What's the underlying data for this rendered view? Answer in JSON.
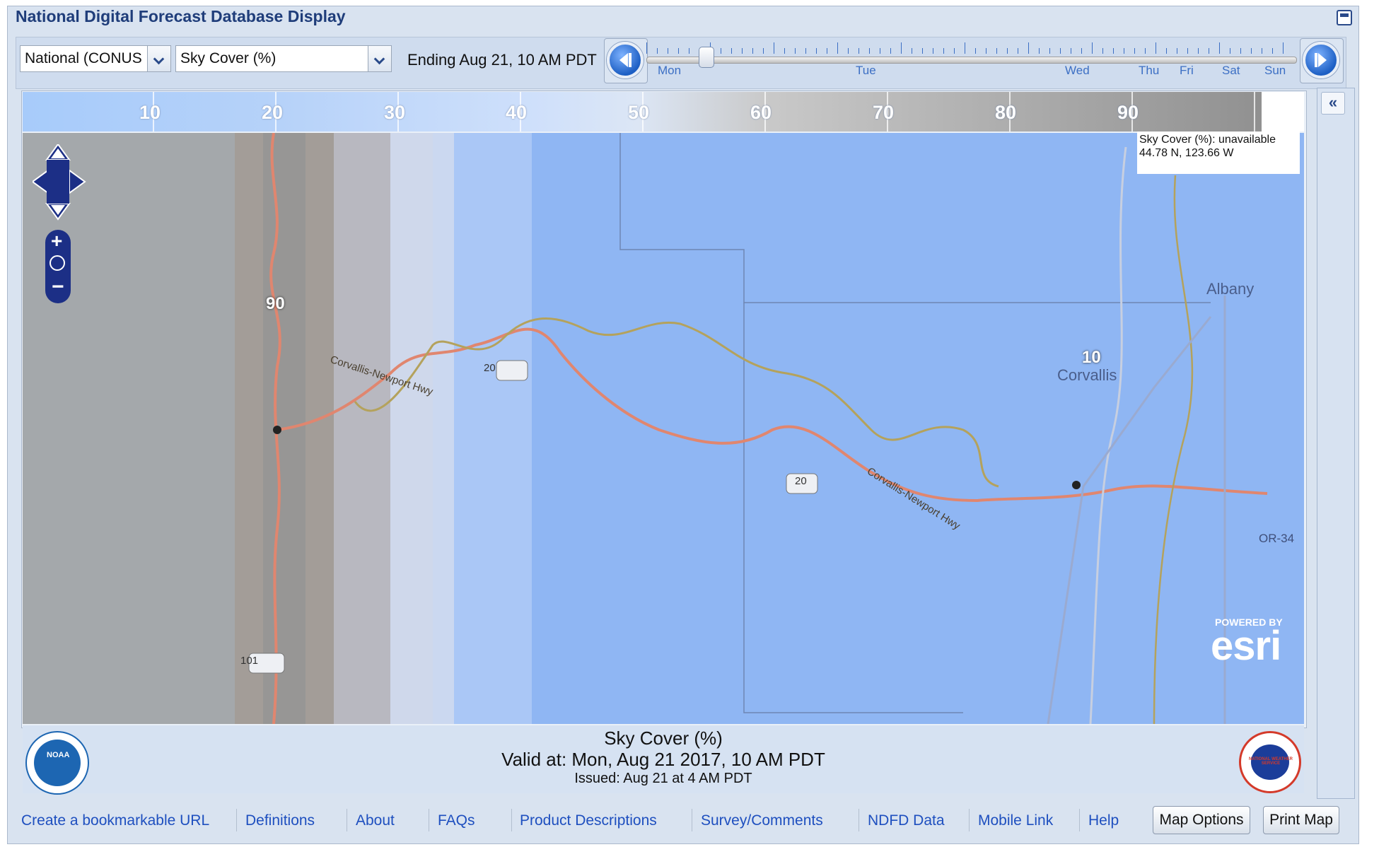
{
  "app": {
    "title": "National Digital Forecast Database Display"
  },
  "toolbar": {
    "region_select": "National (CONUS",
    "element_select": "Sky Cover (%)",
    "ending_label": "Ending Aug 21, 10 AM PDT"
  },
  "timeline": {
    "days": [
      "Mon",
      "Tue",
      "Wed",
      "Thu",
      "Fri",
      "Sat",
      "Sun"
    ]
  },
  "legend": {
    "values": [
      "10",
      "20",
      "30",
      "40",
      "50",
      "60",
      "70",
      "80",
      "90"
    ],
    "color_low": "#a7cbfa",
    "color_high": "#8c8c8c"
  },
  "map": {
    "readout_line1": "Sky Cover (%): unavailable",
    "readout_line2": "44.78 N, 123.66 W",
    "labels": {
      "albany": "Albany",
      "corvallis": "Corvallis",
      "highway_name_1": "Corvallis-Newport Hwy",
      "highway_name_2": "Corvallis-Newport Hwy",
      "route_20a": "20",
      "route_20b": "20",
      "route_101": "101",
      "or34": "OR-34",
      "value_90": "90",
      "value_10": "10"
    },
    "esri_small": "POWERED BY",
    "esri_big": "esri"
  },
  "footer": {
    "product": "Sky Cover (%)",
    "valid": "Valid at: Mon, Aug 21 2017, 10 AM PDT",
    "issued": "Issued: Aug 21 at 4 AM PDT",
    "noaa": "NOAA",
    "nws": "NATIONAL WEATHER SERVICE"
  },
  "links": [
    "Create a bookmarkable URL",
    "Definitions",
    "About",
    "FAQs",
    "Product Descriptions",
    "Survey/Comments",
    "NDFD Data",
    "Mobile Link",
    "Help"
  ],
  "buttons": {
    "map_options": "Map Options",
    "print_map": "Print Map"
  }
}
